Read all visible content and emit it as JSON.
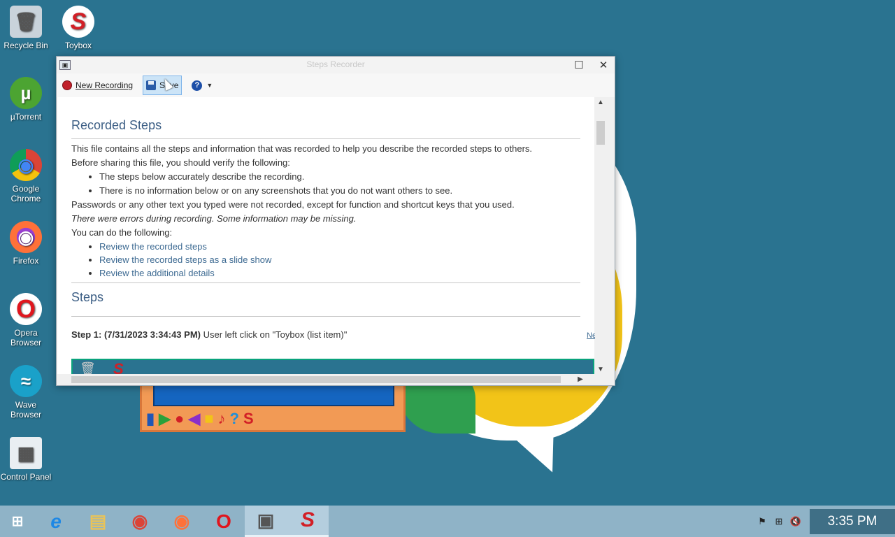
{
  "desktop": {
    "icons": [
      {
        "label": "Recycle Bin",
        "glyph": "🗑"
      },
      {
        "label": "Toybox",
        "glyph": "S"
      },
      {
        "label": "µTorrent",
        "glyph": "µ"
      },
      {
        "label": "Google Chrome",
        "glyph": "◉"
      },
      {
        "label": "Firefox",
        "glyph": "◉"
      },
      {
        "label": "Opera Browser",
        "glyph": "O"
      },
      {
        "label": "Wave Browser",
        "glyph": "≈"
      },
      {
        "label": "Control Panel",
        "glyph": "▦"
      }
    ]
  },
  "window": {
    "title": "Steps Recorder",
    "toolbar": {
      "new_recording": "New Recording",
      "save": "Save",
      "help_glyph": "?",
      "dropdown_glyph": "▼"
    },
    "close_glyph": "✕",
    "maximize_glyph": "☐"
  },
  "content": {
    "heading": "Recorded Steps",
    "intro": "This file contains all the steps and information that was recorded to help you describe the recorded steps to others.",
    "verify_prompt": "Before sharing this file, you should verify the following:",
    "verify_items": [
      "The steps below accurately describe the recording.",
      "There is no information below or on any screenshots that you do not want others to see."
    ],
    "passwords_note": "Passwords or any other text you typed were not recorded, except for function and shortcut keys that you used.",
    "errors_note": "There were errors during recording. Some information may be missing.",
    "can_do": "You can do the following:",
    "links": [
      "Review the recorded steps",
      "Review the recorded steps as a slide show",
      "Review the additional details"
    ],
    "steps_heading": "Steps",
    "step1_label": "Step 1: (7/31/2023 3:34:43 PM)",
    "step1_text": " User left click on \"Toybox (list item)\"",
    "next_link": "Ne"
  },
  "taskbar": {
    "clock": "3:35 PM",
    "start_glyph": "⊞",
    "apps": [
      {
        "name": "internet-explorer",
        "glyph": "e"
      },
      {
        "name": "file-explorer",
        "glyph": "▤"
      },
      {
        "name": "chrome",
        "glyph": "◉"
      },
      {
        "name": "firefox",
        "glyph": "◉"
      },
      {
        "name": "opera",
        "glyph": "O"
      },
      {
        "name": "steps-recorder",
        "glyph": "▣"
      },
      {
        "name": "toybox",
        "glyph": "S"
      }
    ],
    "tray_glyphs": {
      "flag": "⚑",
      "network": "⊞",
      "volume": "🔇"
    }
  },
  "colors": {
    "desktop_bg": "#2a7390",
    "taskbar": "#8fb3c7",
    "clock_bg": "#3f6f86",
    "heading": "#3d5f85",
    "link": "#3d6a92",
    "record_red": "#c0202a"
  }
}
